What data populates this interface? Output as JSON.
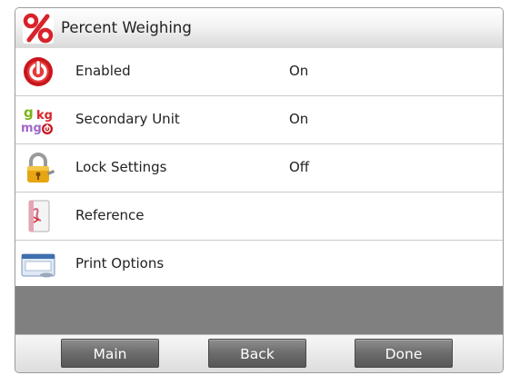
{
  "header": {
    "title": "Percent Weighing",
    "icon": "percent-icon"
  },
  "menu": [
    {
      "label": "Enabled",
      "value": "On",
      "icon": "power-icon"
    },
    {
      "label": "Secondary Unit",
      "value": "On",
      "icon": "units-icon",
      "icon_text": [
        "g",
        "kg",
        "mg"
      ]
    },
    {
      "label": "Lock Settings",
      "value": "Off",
      "icon": "lock-icon"
    },
    {
      "label": "Reference",
      "value": "",
      "icon": "reference-book-icon"
    },
    {
      "label": "Print Options",
      "value": "",
      "icon": "print-options-icon"
    }
  ],
  "footer": {
    "main_label": "Main",
    "back_label": "Back",
    "done_label": "Done"
  },
  "colors": {
    "accent_red": "#d8232a",
    "button_gray": "#6c6c6c",
    "panel_gray": "#808080"
  }
}
